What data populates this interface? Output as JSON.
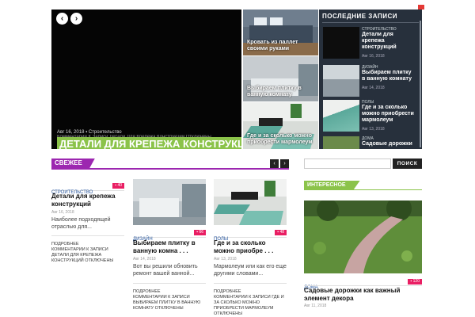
{
  "slider": {
    "prev_arrow": "‹",
    "next_arrow": "›",
    "date": "Авг 16, 2018",
    "category": "Строительство",
    "ghost_text": "Комментарии К Записи Детали Для Крепежа Конструкций Отключены",
    "headline": "ДЕТАЛИ ДЛЯ КРЕПЕЖА КОНСТРУКЦИИ"
  },
  "tiles": [
    {
      "caption": "Кровать из паллет своими руками"
    },
    {
      "caption": "Выбираем плитку в ванную комнату"
    },
    {
      "caption": "Где и за сколько можно приобрести мармолеум"
    }
  ],
  "recent": {
    "title": "ПОСЛЕДНИЕ ЗАПИСИ",
    "items": [
      {
        "category": "СТРОИТЕЛЬСТВО",
        "title": "Детали для крепежа конструкций",
        "date": "Авг 16, 2018"
      },
      {
        "category": "ДИЗАЙН",
        "title": "Выбираем плитку в ванную комнату",
        "date": "Авг 14, 2018"
      },
      {
        "category": "ПОЛЫ",
        "title": "Где и за сколько можно приобрести мармолеум",
        "date": "Авг 13, 2018"
      },
      {
        "category": "ДОМА",
        "title": "Садовые дорожки",
        "date": ""
      }
    ]
  },
  "section": {
    "label": "СВЕЖЕЕ",
    "prev": "‹",
    "next": "›"
  },
  "posts": [
    {
      "category": "СТРОИТЕЛЬСТВО",
      "badge": "40",
      "title": "Детали для крепежа конструкций",
      "date": "Авг 16, 2018",
      "excerpt": "Наиболее подходящей отраслью для...",
      "more": "ПОДРОБНЕЕ",
      "comments": "КОММЕНТАРИИ К ЗАПИСИ ДЕТАЛИ ДЛЯ КРЕПЕЖА КОНСТРУКЦИЙ ОТКЛЮЧЕНЫ"
    },
    {
      "category": "ДИЗАЙН",
      "badge": "66",
      "title": "Выбираем плитку в ванную комна . . .",
      "date": "Авг 14, 2018",
      "excerpt": "Вот вы решили обновить ремонт вашей ванной...",
      "more": "ПОДРОБНЕЕ",
      "comments": "КОММЕНТАРИИ К ЗАПИСИ ВЫБИРАЕМ ПЛИТКУ В ВАННУЮ КОМНАТУ ОТКЛЮЧЕНЫ"
    },
    {
      "category": "ПОЛЫ",
      "badge": "48",
      "title": "Где и за сколько можно приобре . . .",
      "date": "Авг 13, 2018",
      "excerpt": "Мармолеум или как его еще другими словами...",
      "more": "ПОДРОБНЕЕ",
      "comments": "КОММЕНТАРИИ К ЗАПИСИ ГДЕ И ЗА СКОЛЬКО МОЖНО ПРИОБРЕСТИ МАРМОЛЕУМ ОТКЛЮЧЕНЫ"
    }
  ],
  "sidebar": {
    "search_button": "ПОИСК",
    "widget_title": "ИНТЕРЕСНОЕ",
    "post": {
      "category": "ДОМА",
      "badge": "120",
      "title": "Садовые дорожки как важный элемент декора",
      "date": "Авг 11, 2018"
    }
  },
  "colors": {
    "accent_green": "#8bc34a",
    "accent_purple": "#9c27b0",
    "badge_pink": "#e91e63",
    "panel_dark": "#27303c"
  }
}
